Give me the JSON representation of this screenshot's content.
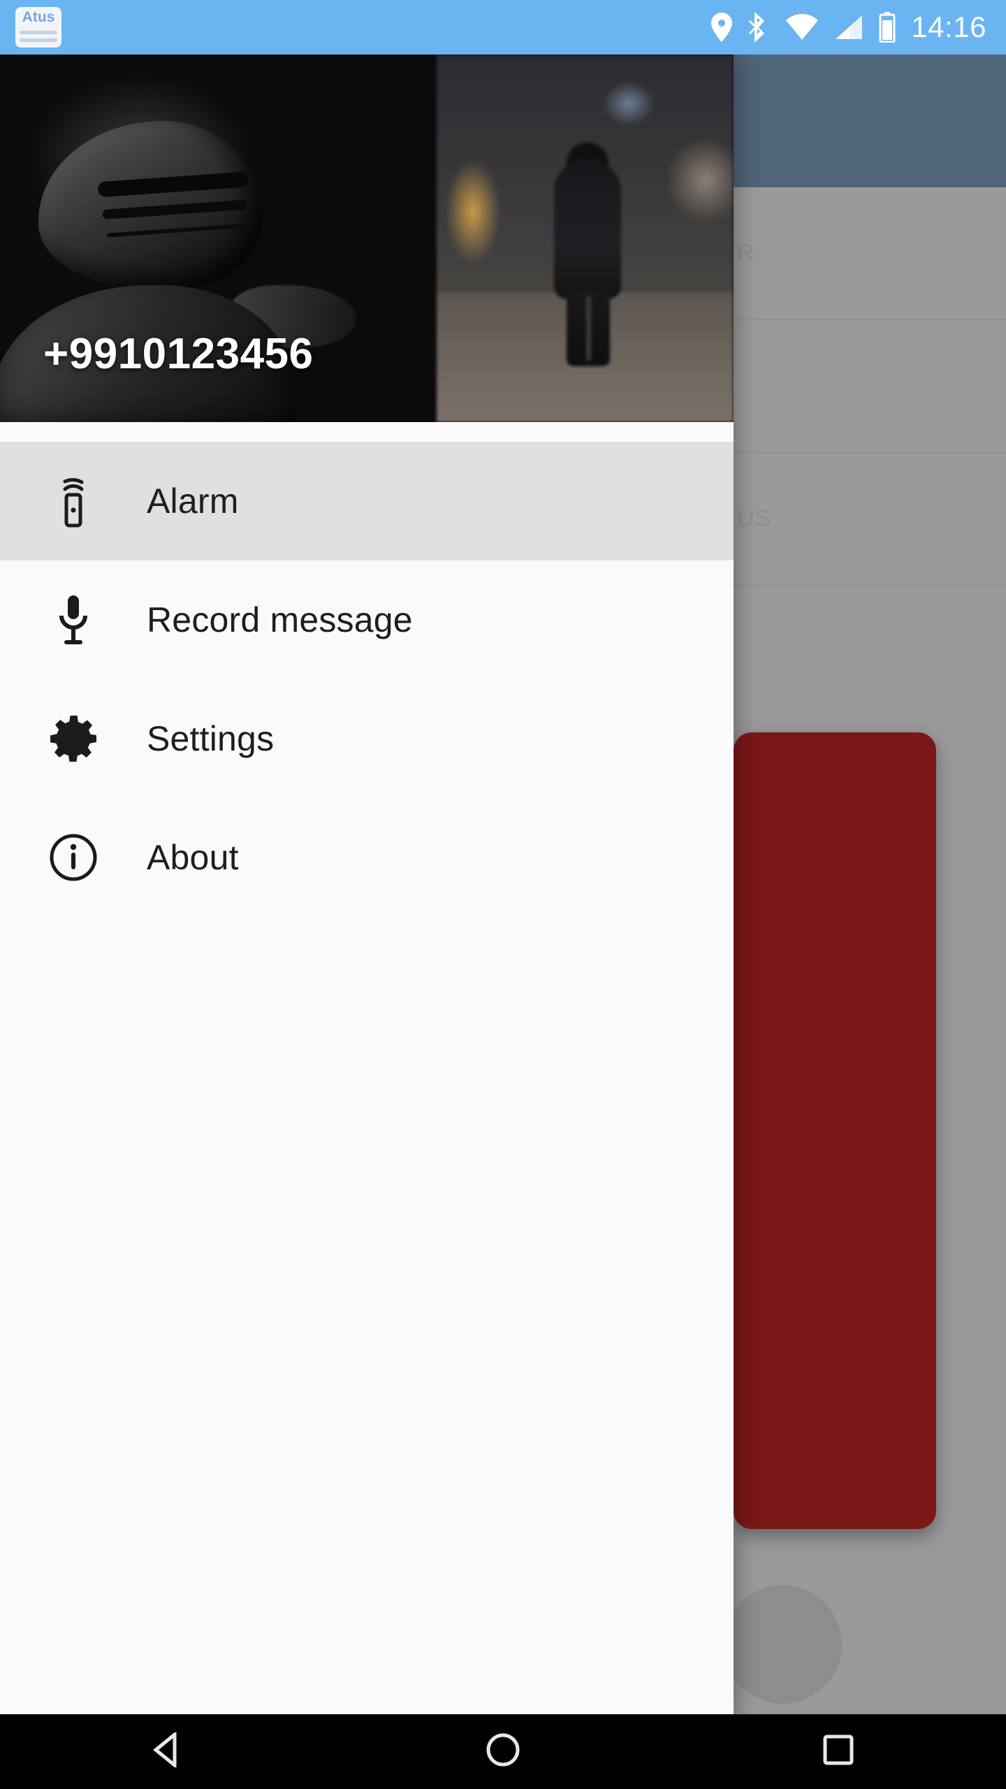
{
  "status_bar": {
    "app_badge_label": "Atus",
    "clock": "14:16",
    "icons": [
      "location-pin-icon",
      "bluetooth-icon",
      "wifi-icon",
      "cell-signal-icon",
      "battery-icon"
    ],
    "background_color": "#6ab4f1"
  },
  "drawer": {
    "phone_number": "+9910123456",
    "items": [
      {
        "label": "Alarm",
        "icon": "alarm-siren-icon",
        "selected": true
      },
      {
        "label": "Record message",
        "icon": "microphone-icon",
        "selected": false
      },
      {
        "label": "Settings",
        "icon": "gear-icon",
        "selected": false
      },
      {
        "label": "About",
        "icon": "info-circle-icon",
        "selected": false
      }
    ],
    "selected_background": "#e0e0e0",
    "background_color": "#fafafa"
  },
  "background_app": {
    "appbar_color": "#4f6478",
    "scrim_color": "#9a9a9a",
    "rows": [
      "R",
      "",
      "US"
    ],
    "card_color": "#7a1717"
  },
  "nav_bar": {
    "buttons": [
      {
        "label": "Back",
        "icon": "triangle-back-icon"
      },
      {
        "label": "Home",
        "icon": "circle-home-icon"
      },
      {
        "label": "Recents",
        "icon": "square-recents-icon"
      }
    ],
    "background_color": "#000000"
  }
}
